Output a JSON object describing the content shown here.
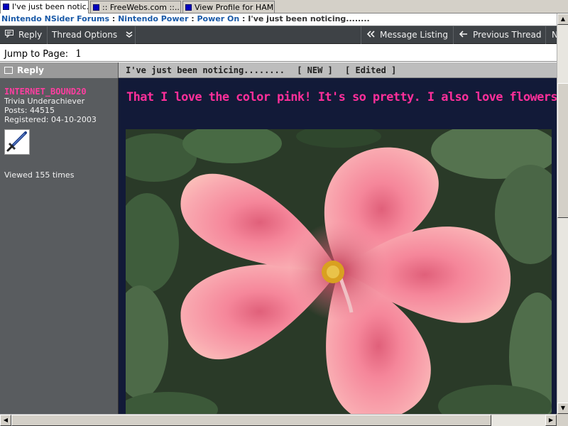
{
  "browser": {
    "tabs": [
      {
        "label": "I've just been notic...",
        "active": true
      },
      {
        "label": ":: FreeWebs.com ::....",
        "active": false
      },
      {
        "label": "View Profile for HAM...",
        "active": false
      }
    ]
  },
  "breadcrumb": {
    "items": [
      "Nintendo NSider Forums",
      "Nintendo Power",
      "Power On"
    ],
    "separator": ":",
    "current": "I've just been noticing........"
  },
  "toolbar": {
    "reply_label": "Reply",
    "thread_options_label": "Thread Options",
    "message_listing_label": "Message Listing",
    "previous_thread_label": "Previous Thread",
    "next_partial_label": "N"
  },
  "jump": {
    "label": "Jump to Page:",
    "page": "1"
  },
  "post": {
    "reply_label": "Reply",
    "title": "I've just been noticing........",
    "new_tag": "[ NEW ]",
    "edited_tag": "[ Edited ]",
    "body_text": "That I love the color pink!  It's so pretty.  I also love flowers!",
    "image_subject": "pink-hibiscus-flower"
  },
  "user": {
    "name": "INTERNET_BOUND20",
    "rank": "Trivia Underachiever",
    "posts": "Posts: 44515",
    "registered": "Registered: 04-10-2003",
    "avatar_icon": "sword-icon",
    "viewed": "Viewed 155 times"
  },
  "colors": {
    "username": "#ff3ea0",
    "post_text": "#ff2f9a",
    "post_bg": "#121a38",
    "toolbar_bg": "#3e4246",
    "breadcrumb_link": "#1a5aa8"
  }
}
